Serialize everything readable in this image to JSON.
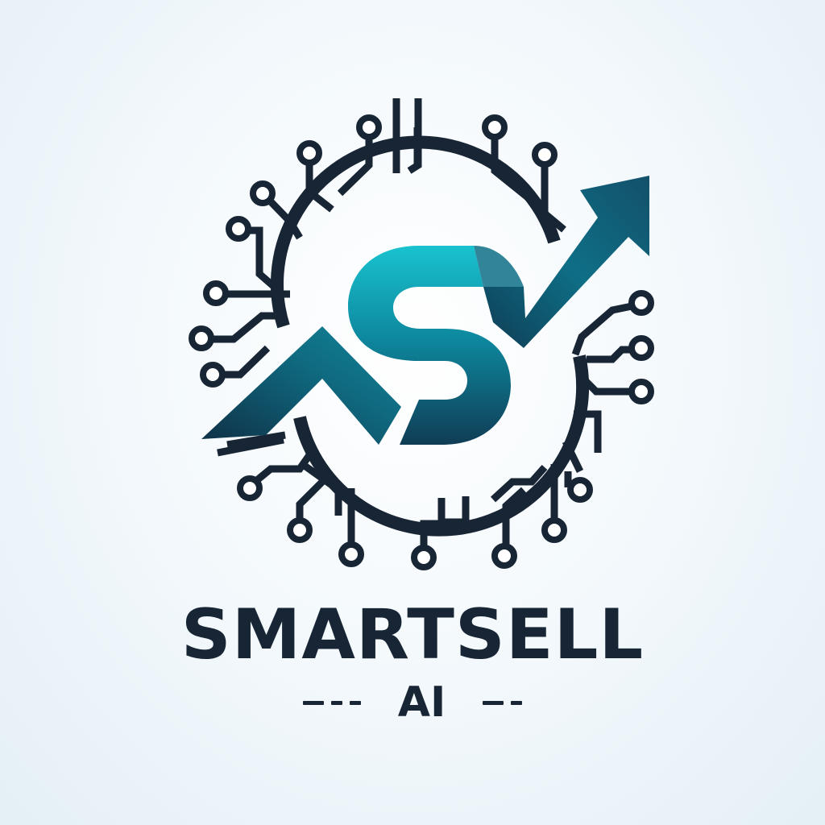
{
  "brand": {
    "name": "SMARTSELL",
    "tagline": "AI"
  },
  "colors": {
    "dark": "#172534",
    "teal_light": "#19c2cf",
    "teal_mid": "#0e6f86",
    "teal_dark": "#0f3d55",
    "background": "#eef6fa"
  },
  "icons": [
    "circuit-ring-icon",
    "s-letter-icon",
    "trend-arrow-icon"
  ]
}
